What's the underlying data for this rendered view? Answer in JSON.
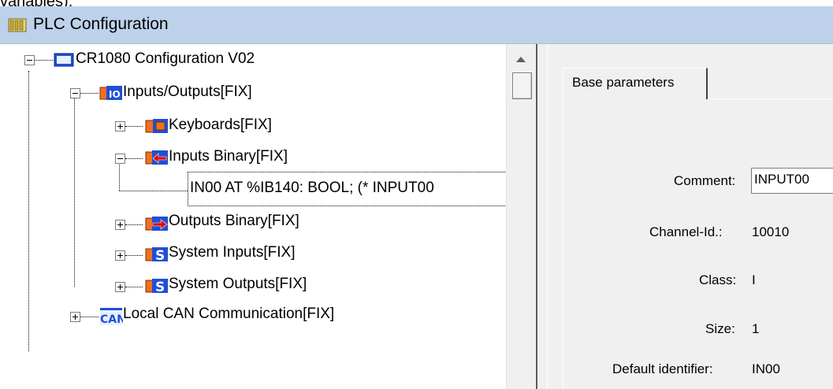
{
  "clipped_caption": "variables).",
  "window": {
    "title": "PLC Configuration"
  },
  "tree": {
    "root": {
      "label": "CR1080 Configuration V02"
    },
    "items": [
      {
        "label": "Inputs/Outputs[FIX]"
      },
      {
        "label": "Keyboards[FIX]"
      },
      {
        "label": "Inputs Binary[FIX]"
      },
      {
        "label": "IN00 AT %IB140: BOOL; (* INPUT00"
      },
      {
        "label": "Outputs Binary[FIX]"
      },
      {
        "label": "System Inputs[FIX]"
      },
      {
        "label": "System Outputs[FIX]"
      },
      {
        "label": "Local CAN Communication[FIX]"
      }
    ]
  },
  "properties": {
    "tab_label": "Base parameters",
    "fields": {
      "comment": {
        "label": "Comment:",
        "value": "INPUT00"
      },
      "channel_id": {
        "label": "Channel-Id.:",
        "value": "10010"
      },
      "class": {
        "label": "Class:",
        "value": "I"
      },
      "size": {
        "label": "Size:",
        "value": "1"
      },
      "default_identifier": {
        "label": "Default identifier:",
        "value": "IN00"
      }
    }
  },
  "colors": {
    "titlebar": "#bdd1ea",
    "icon_blue": "#1f4fd8",
    "icon_orange": "#f07020",
    "icon_red": "#e01010"
  }
}
